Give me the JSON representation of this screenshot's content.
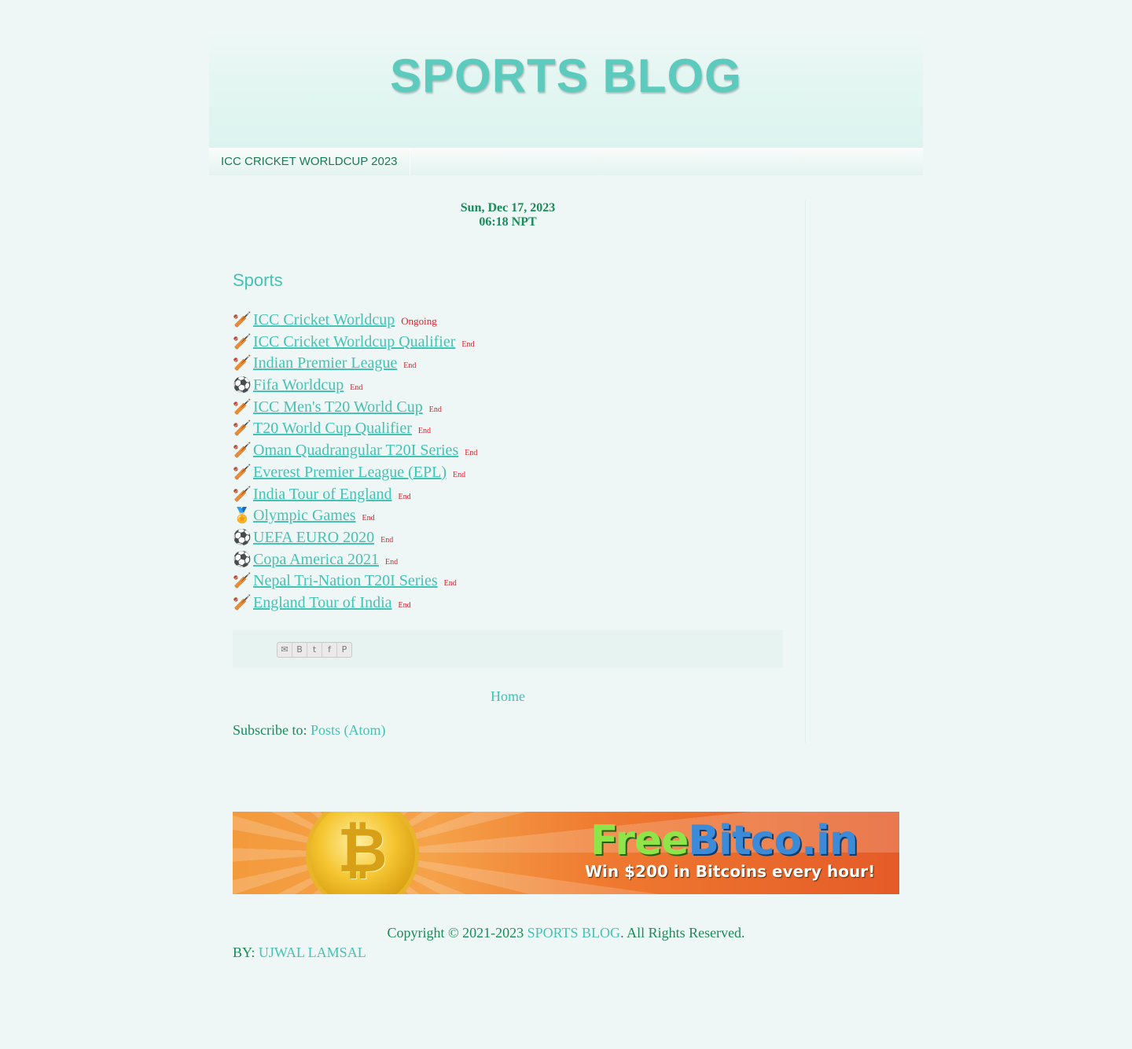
{
  "header": {
    "title": "SPORTS BLOG"
  },
  "nav": {
    "tabs": [
      {
        "label": "ICC CRICKET WORLDCUP 2023"
      }
    ]
  },
  "datetime": {
    "date": "Sun, Dec 17, 2023",
    "time": "06:18 NPT"
  },
  "post": {
    "title": "Sports",
    "events": [
      {
        "icon": "cricket-bat-icon",
        "glyph": "🏏",
        "name": "ICC Cricket Worldcup",
        "status": "Ongoing"
      },
      {
        "icon": "cricket-bat-icon",
        "glyph": "🏏",
        "name": "ICC Cricket Worldcup Qualifier",
        "status": "End"
      },
      {
        "icon": "cricket-bat-icon",
        "glyph": "🏏",
        "name": "Indian Premier League",
        "status": "End"
      },
      {
        "icon": "soccer-ball-icon",
        "glyph": "⚽",
        "name": "Fifa Worldcup",
        "status": "End"
      },
      {
        "icon": "cricket-bat-icon",
        "glyph": "🏏",
        "name": "ICC Men's T20 World Cup",
        "status": "End"
      },
      {
        "icon": "cricket-bat-icon",
        "glyph": "🏏",
        "name": "T20 World Cup Qualifier",
        "status": "End"
      },
      {
        "icon": "cricket-bat-icon",
        "glyph": "🏏",
        "name": "Oman Quadrangular T20I Series",
        "status": "End"
      },
      {
        "icon": "cricket-bat-icon",
        "glyph": "🏏",
        "name": "Everest Premier League (EPL)",
        "status": "End"
      },
      {
        "icon": "cricket-bat-icon",
        "glyph": "🏏",
        "name": "India Tour of England",
        "status": "End"
      },
      {
        "icon": "medal-icon",
        "glyph": "🏅",
        "name": "Olympic Games",
        "status": "End"
      },
      {
        "icon": "soccer-ball-icon",
        "glyph": "⚽",
        "name": "UEFA EURO 2020",
        "status": "End"
      },
      {
        "icon": "soccer-ball-icon",
        "glyph": "⚽",
        "name": "Copa America 2021",
        "status": "End"
      },
      {
        "icon": "cricket-bat-icon",
        "glyph": "🏏",
        "name": "Nepal Tri-Nation T20I Series",
        "status": "End"
      },
      {
        "icon": "cricket-bat-icon",
        "glyph": "🏏",
        "name": "England Tour of India",
        "status": "End"
      }
    ]
  },
  "share": {
    "icons": [
      "email-icon",
      "blogger-icon",
      "twitter-icon",
      "facebook-icon",
      "pinterest-icon"
    ]
  },
  "pager": {
    "home": "Home"
  },
  "subscribe": {
    "label": "Subscribe to: ",
    "link": "Posts (Atom)"
  },
  "banner": {
    "brand_free": "Free",
    "brand_bitco": "Bitco.in",
    "tagline": "Win $200 in Bitcoins every hour!"
  },
  "footer": {
    "copyright_prefix": "Copyright © 2021-2023 ",
    "blog_link": "SPORTS BLOG",
    "copyright_suffix": ". All Rights Reserved.",
    "by_label": "BY: ",
    "author": "UJWAL LAMSAL"
  },
  "colors": {
    "accent": "#45c2b3",
    "title": "#5ccbbd",
    "text": "#1b8a5a",
    "status": "#e0202a",
    "background": "#eef7f5"
  }
}
